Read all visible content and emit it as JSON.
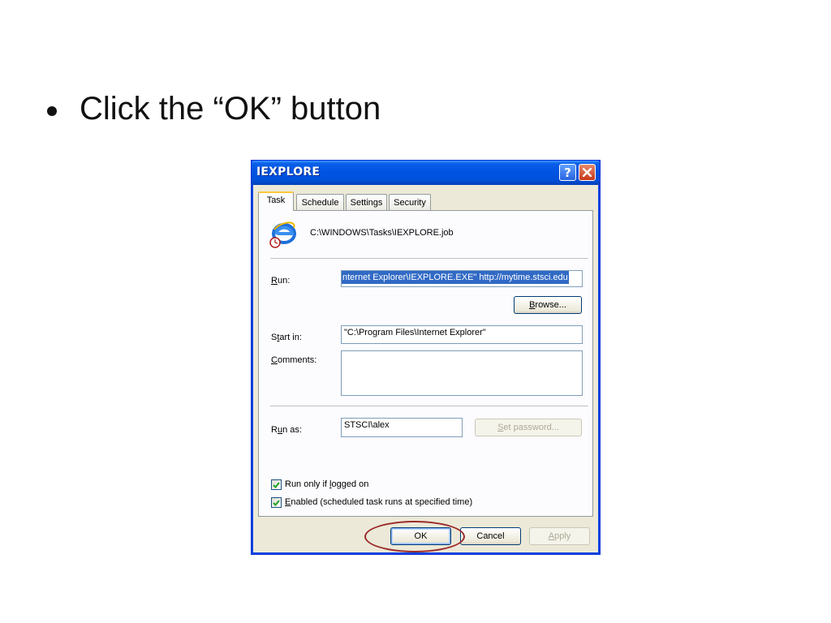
{
  "slide": {
    "instruction": "Click the “OK” button"
  },
  "dialog": {
    "title": "IEXPLORE",
    "tabs": [
      {
        "label": "Task"
      },
      {
        "label": "Schedule"
      },
      {
        "label": "Settings"
      },
      {
        "label": "Security"
      }
    ],
    "job_path": "C:\\WINDOWS\\Tasks\\IEXPLORE.job",
    "run": {
      "label_pre": "",
      "label_key": "R",
      "label_post": "un:",
      "value": "nternet Explorer\\IEXPLORE.EXE\" http://mytime.stsci.edu"
    },
    "browse_key": "B",
    "browse_rest": "rowse...",
    "start_in": {
      "label_pre": "S",
      "label_key": "t",
      "label_post": "art in:",
      "value": "\"C:\\Program Files\\Internet Explorer\""
    },
    "comments": {
      "label_key": "C",
      "label_post": "omments:",
      "value": ""
    },
    "run_as": {
      "label_pre": "R",
      "label_key": "u",
      "label_post": "n as:",
      "value": "STSCI\\alex"
    },
    "set_password_key": "S",
    "set_password_rest": "et password...",
    "checkboxes": [
      {
        "pre": "Run only if ",
        "key": "l",
        "post": "ogged on",
        "checked": true
      },
      {
        "pre": "",
        "key": "E",
        "post": "nabled (scheduled task runs at specified time)",
        "checked": true
      }
    ],
    "buttons": {
      "ok": "OK",
      "cancel": "Cancel",
      "apply_key": "A",
      "apply_rest": "pply"
    }
  },
  "colors": {
    "titlebar": "#0054e3",
    "dialog_bg": "#ece9d8",
    "selection": "#316ac5",
    "highlight_ellipse": "#9c2a2a"
  },
  "icons": {
    "app": "internet-explorer-scheduled-icon",
    "help": "help-icon",
    "close": "close-icon",
    "checkbox": "checkmark-icon"
  }
}
